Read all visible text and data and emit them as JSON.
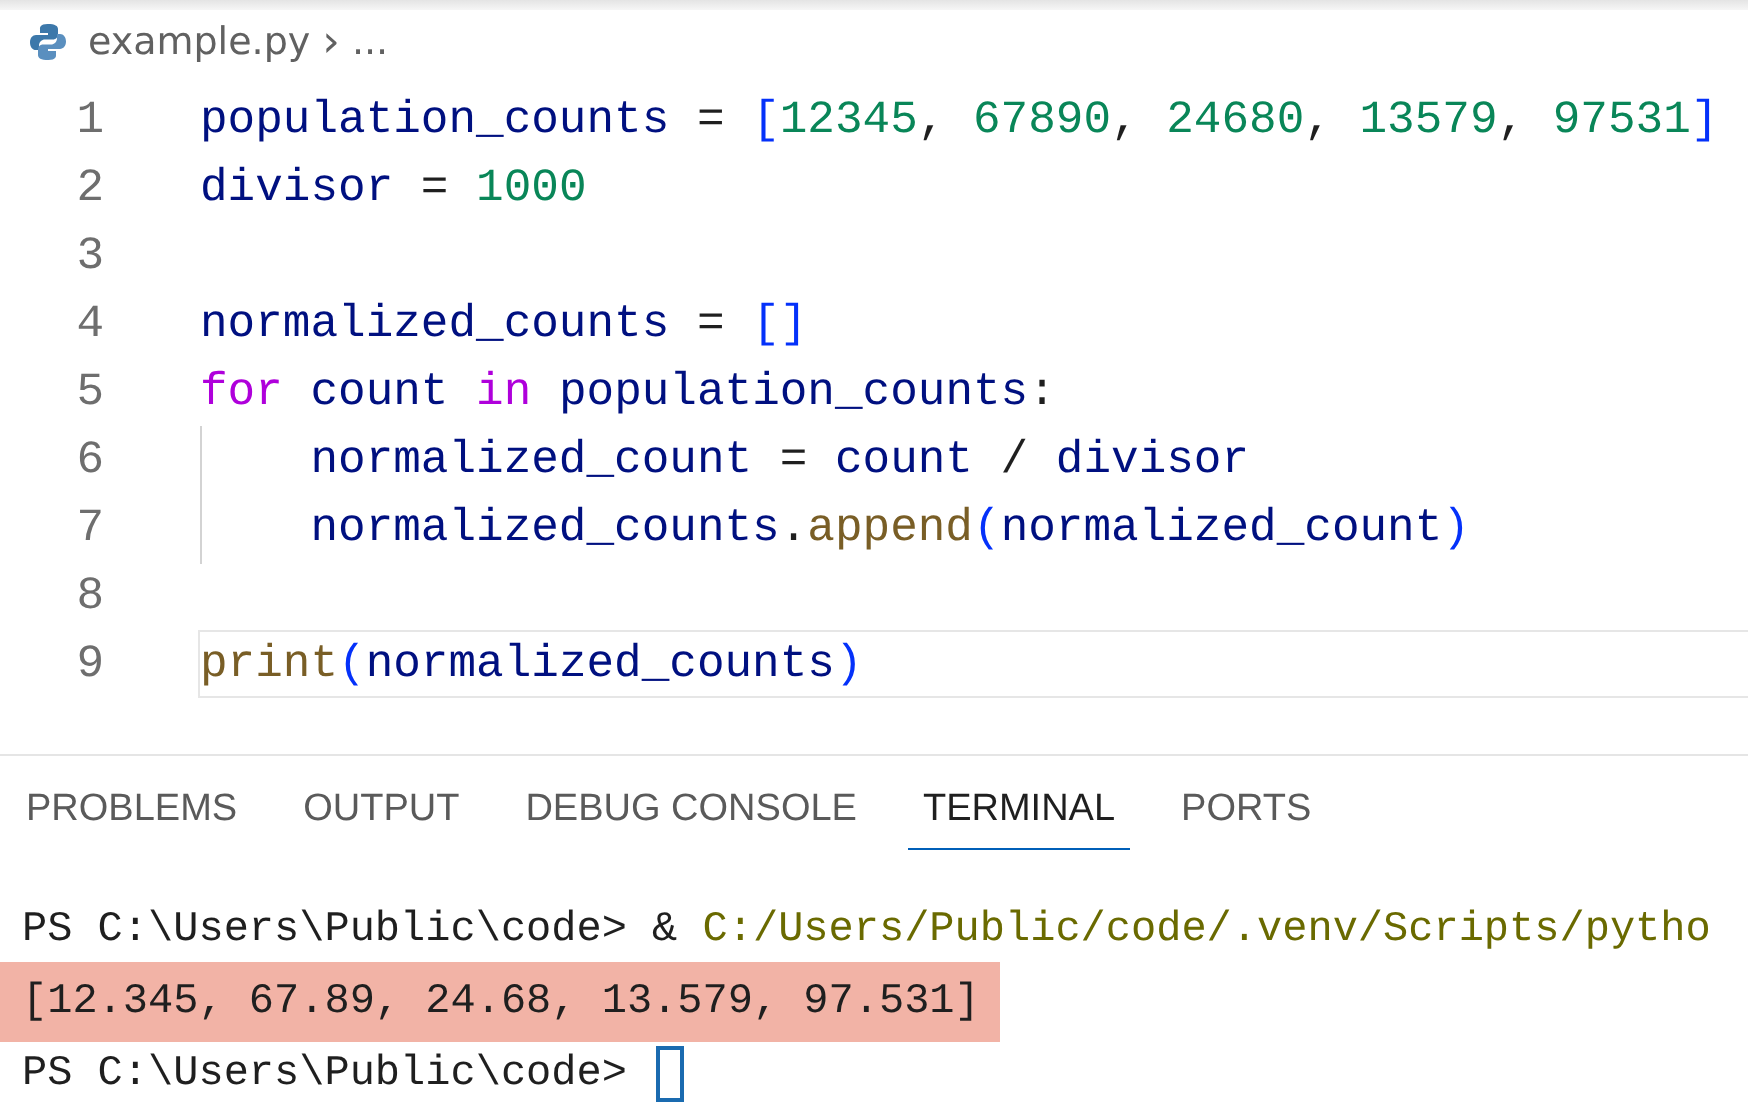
{
  "breadcrumb": {
    "file": "example.py",
    "separator": "›",
    "more": "..."
  },
  "code_lines": [
    {
      "number": "1",
      "current": false,
      "tokens": [
        {
          "kind": "var",
          "text": "population_counts"
        },
        {
          "kind": "op",
          "text": " = "
        },
        {
          "kind": "bracket",
          "text": "["
        },
        {
          "kind": "num",
          "text": "12345"
        },
        {
          "kind": "op",
          "text": ", "
        },
        {
          "kind": "num",
          "text": "67890"
        },
        {
          "kind": "op",
          "text": ", "
        },
        {
          "kind": "num",
          "text": "24680"
        },
        {
          "kind": "op",
          "text": ", "
        },
        {
          "kind": "num",
          "text": "13579"
        },
        {
          "kind": "op",
          "text": ", "
        },
        {
          "kind": "num",
          "text": "97531"
        },
        {
          "kind": "bracket",
          "text": "]"
        }
      ]
    },
    {
      "number": "2",
      "current": false,
      "tokens": [
        {
          "kind": "var",
          "text": "divisor"
        },
        {
          "kind": "op",
          "text": " = "
        },
        {
          "kind": "num",
          "text": "1000"
        }
      ]
    },
    {
      "number": "3",
      "current": false
    },
    {
      "number": "4",
      "current": false,
      "tokens": [
        {
          "kind": "var",
          "text": "normalized_counts"
        },
        {
          "kind": "op",
          "text": " = "
        },
        {
          "kind": "bracket",
          "text": "[]"
        }
      ]
    },
    {
      "number": "5",
      "current": false,
      "tokens": [
        {
          "kind": "kw",
          "text": "for"
        },
        {
          "kind": "var",
          "text": " count "
        },
        {
          "kind": "kw",
          "text": "in"
        },
        {
          "kind": "var",
          "text": " population_counts"
        },
        {
          "kind": "op",
          "text": ":"
        }
      ]
    },
    {
      "number": "6",
      "current": false,
      "tokens": [
        {
          "kind": "var",
          "text": "    normalized_count"
        },
        {
          "kind": "op",
          "text": " = "
        },
        {
          "kind": "var",
          "text": "count"
        },
        {
          "kind": "op",
          "text": " / "
        },
        {
          "kind": "var",
          "text": "divisor"
        }
      ]
    },
    {
      "number": "7",
      "current": false,
      "tokens": [
        {
          "kind": "var",
          "text": "    normalized_counts"
        },
        {
          "kind": "op",
          "text": "."
        },
        {
          "kind": "fn",
          "text": "append"
        },
        {
          "kind": "bracket",
          "text": "("
        },
        {
          "kind": "var",
          "text": "normalized_count"
        },
        {
          "kind": "bracket",
          "text": ")"
        }
      ]
    },
    {
      "number": "8",
      "current": false
    },
    {
      "number": "9",
      "current": true,
      "tokens": [
        {
          "kind": "fn",
          "text": "print"
        },
        {
          "kind": "bracket",
          "text": "("
        },
        {
          "kind": "var",
          "text": "normalized_counts"
        },
        {
          "kind": "bracket",
          "text": ")"
        }
      ]
    }
  ],
  "panel_tabs": [
    {
      "label": "PROBLEMS",
      "selected": false
    },
    {
      "label": "OUTPUT",
      "selected": false
    },
    {
      "label": "DEBUG CONSOLE",
      "selected": false
    },
    {
      "label": "TERMINAL",
      "selected": true
    },
    {
      "label": "PORTS",
      "selected": false
    }
  ],
  "terminal_lines": [
    {
      "highlighted": false,
      "cursor": false,
      "tokens": [
        {
          "kind": "plain",
          "text": "PS C:\\Users\\Public\\code> & "
        },
        {
          "kind": "path",
          "text": "C:/Users/Public/code/.venv/Scripts/pytho"
        }
      ]
    },
    {
      "highlighted": true,
      "cursor": false,
      "tokens": [
        {
          "kind": "plain",
          "text": "[12.345, 67.89, 24.68, 13.579, 97.531]"
        }
      ]
    },
    {
      "highlighted": false,
      "cursor": true,
      "tokens": [
        {
          "kind": "plain",
          "text": "PS C:\\Users\\Public\\code> "
        }
      ]
    }
  ]
}
